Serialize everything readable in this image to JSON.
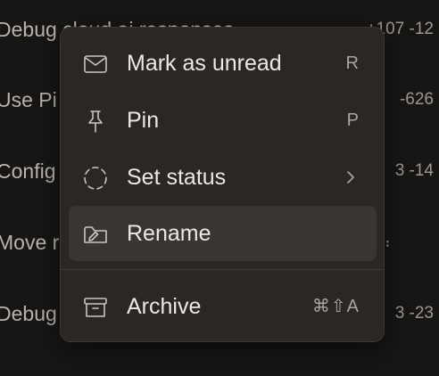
{
  "background_list": {
    "rows": [
      {
        "title": "Debug cloud ai responses",
        "stat": "+107 -12"
      },
      {
        "title": "Use Pi",
        "stat": "-626"
      },
      {
        "title": "Config",
        "stat": "3 -14"
      },
      {
        "title": "Move r",
        "stat": ""
      },
      {
        "title": "Debug",
        "stat": "3 -23"
      }
    ]
  },
  "context_menu": {
    "items": [
      {
        "label": "Mark as unread",
        "shortcut": "R",
        "icon": "mail-icon"
      },
      {
        "label": "Pin",
        "shortcut": "P",
        "icon": "pin-icon"
      },
      {
        "label": "Set status",
        "shortcut": "",
        "icon": "dashed-circle-icon",
        "has_submenu": true
      },
      {
        "label": "Rename",
        "shortcut": "",
        "icon": "folder-rename-icon",
        "hovered": true
      },
      {
        "label": "Archive",
        "shortcut": "⌘⇧A",
        "icon": "archive-box-icon"
      }
    ]
  },
  "colors": {
    "background": "#171615",
    "menu_background": "#2a2725",
    "hover_background": "#393532",
    "text": "#ece9e5",
    "muted_text": "#a9a5a0"
  }
}
